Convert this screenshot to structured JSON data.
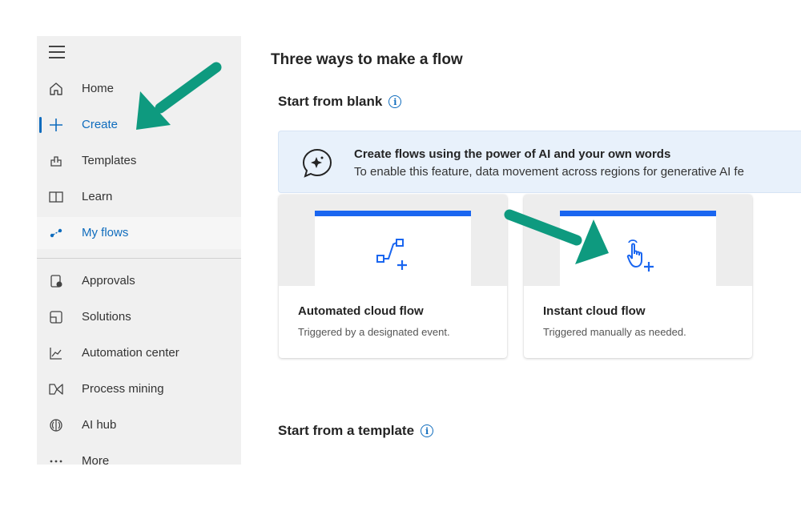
{
  "sidebar": {
    "items": [
      {
        "label": "Home",
        "icon": "home-icon"
      },
      {
        "label": "Create",
        "icon": "plus-icon"
      },
      {
        "label": "Templates",
        "icon": "templates-icon"
      },
      {
        "label": "Learn",
        "icon": "book-icon"
      },
      {
        "label": "My flows",
        "icon": "flow-icon"
      },
      {
        "label": "Approvals",
        "icon": "approvals-icon"
      },
      {
        "label": "Solutions",
        "icon": "solutions-icon"
      },
      {
        "label": "Automation center",
        "icon": "chart-icon"
      },
      {
        "label": "Process mining",
        "icon": "process-mining-icon"
      },
      {
        "label": "AI hub",
        "icon": "ai-hub-icon"
      },
      {
        "label": "More",
        "icon": "more-icon"
      }
    ]
  },
  "main": {
    "title": "Three ways to make a flow",
    "blank_section": "Start from blank",
    "template_section": "Start from a template",
    "ai_banner": {
      "headline": "Create flows using the power of AI and your own words",
      "description": "To enable this feature, data movement across regions for generative AI fe"
    },
    "cards": [
      {
        "title": "Automated cloud flow",
        "subtitle": "Triggered by a designated event."
      },
      {
        "title": "Instant cloud flow",
        "subtitle": "Triggered manually as needed."
      }
    ]
  },
  "colors": {
    "accent": "#0f6cbd",
    "annotation_arrow": "#0e9a7f",
    "card_bar": "#1a66f0"
  }
}
